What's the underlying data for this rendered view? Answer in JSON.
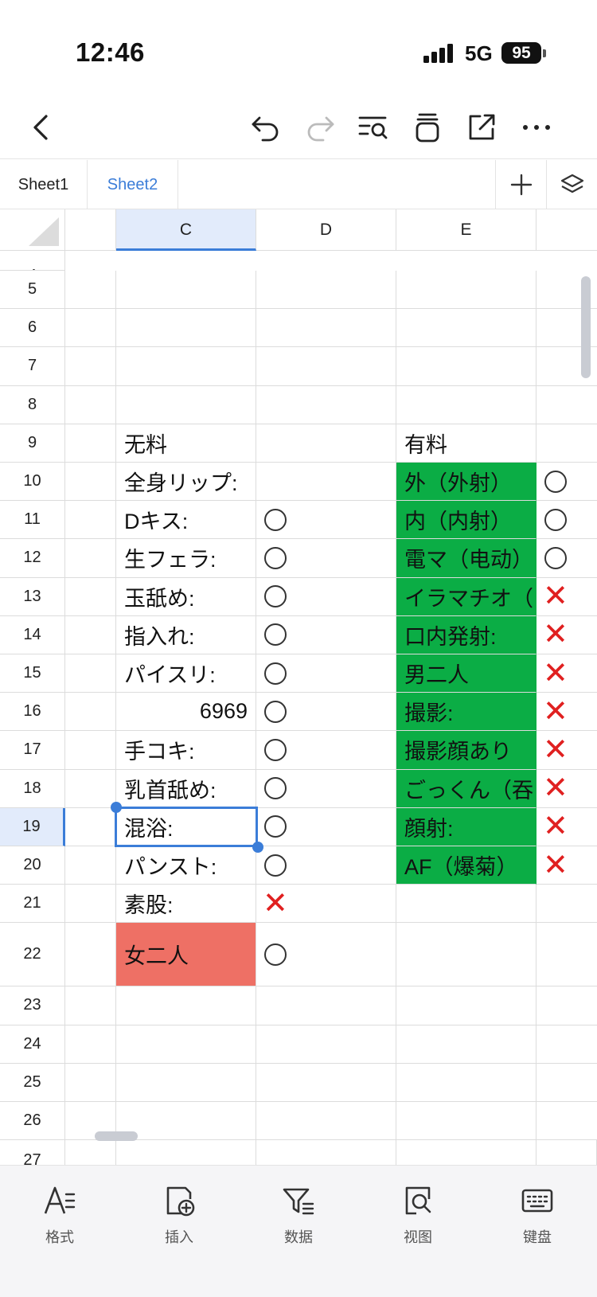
{
  "status_bar": {
    "time": "12:46",
    "network": "5G",
    "battery": "95"
  },
  "toolbar": {
    "icons": [
      "back-icon",
      "undo-icon",
      "redo-icon",
      "find-icon",
      "clear-icon",
      "share-icon",
      "more-icon"
    ]
  },
  "tabs": [
    {
      "label": "Sheet1",
      "active": false
    },
    {
      "label": "Sheet2",
      "active": true
    }
  ],
  "grid": {
    "columns": [
      "C",
      "D",
      "E"
    ],
    "active_column": "C",
    "partial_row_top": "4",
    "partial_row_bottom": "27",
    "active_row": "19",
    "rows": [
      {
        "n": "5",
        "c": "",
        "d": "",
        "e": "",
        "f": ""
      },
      {
        "n": "6",
        "c": "",
        "d": "",
        "e": "",
        "f": ""
      },
      {
        "n": "7",
        "c": "",
        "d": "",
        "e": "",
        "f": ""
      },
      {
        "n": "8",
        "c": "",
        "d": "",
        "e": "",
        "f": ""
      },
      {
        "n": "9",
        "c": "无料",
        "d": "",
        "e": "有料",
        "f": ""
      },
      {
        "n": "10",
        "c": "全身リップ:",
        "d": "",
        "e": "外（外射）",
        "f": "○"
      },
      {
        "n": "11",
        "c": "Dキス:",
        "d": "○",
        "e": "内（内射）",
        "f": "○"
      },
      {
        "n": "12",
        "c": "生フェラ:",
        "d": "○",
        "e": "電マ（电动）",
        "f": "○"
      },
      {
        "n": "13",
        "c": "玉舐め:",
        "d": "○",
        "e": "イラマチオ（",
        "f": "✕"
      },
      {
        "n": "14",
        "c": "指入れ:",
        "d": "○",
        "e": "口内発射:",
        "f": "✕"
      },
      {
        "n": "15",
        "c": "パイスリ:",
        "d": "○",
        "e": "男二人",
        "f": "✕"
      },
      {
        "n": "16",
        "c": "6969",
        "d": "○",
        "e": "撮影:",
        "f": "✕"
      },
      {
        "n": "17",
        "c": "手コキ:",
        "d": "○",
        "e": "撮影顔あり",
        "f": "✕"
      },
      {
        "n": "18",
        "c": "乳首舐め:",
        "d": "○",
        "e": "ごっくん（吞",
        "f": "✕"
      },
      {
        "n": "19",
        "c": "混浴:",
        "d": "○",
        "e": "顔射:",
        "f": "✕"
      },
      {
        "n": "20",
        "c": "パンスト:",
        "d": "○",
        "e": "AF（爆菊）",
        "f": "✕"
      },
      {
        "n": "21",
        "c": "素股:",
        "d": "✕",
        "e": "",
        "f": ""
      },
      {
        "n": "22",
        "c": "女二人",
        "d": "○",
        "e": "",
        "f": ""
      },
      {
        "n": "23",
        "c": "",
        "d": "",
        "e": "",
        "f": ""
      },
      {
        "n": "24",
        "c": "",
        "d": "",
        "e": "",
        "f": ""
      },
      {
        "n": "25",
        "c": "",
        "d": "",
        "e": "",
        "f": ""
      },
      {
        "n": "26",
        "c": "",
        "d": "",
        "e": "",
        "f": ""
      }
    ],
    "colors": {
      "paid_fill": "#0bad45",
      "highlight_fill": "#ee7065",
      "selection": "#3b7dd8",
      "cross": "#e02020"
    }
  },
  "bottom_bar": [
    {
      "label": "格式",
      "icon": "format-icon"
    },
    {
      "label": "插入",
      "icon": "insert-icon"
    },
    {
      "label": "数据",
      "icon": "filter-icon"
    },
    {
      "label": "视图",
      "icon": "view-icon"
    },
    {
      "label": "键盘",
      "icon": "keyboard-icon"
    }
  ]
}
